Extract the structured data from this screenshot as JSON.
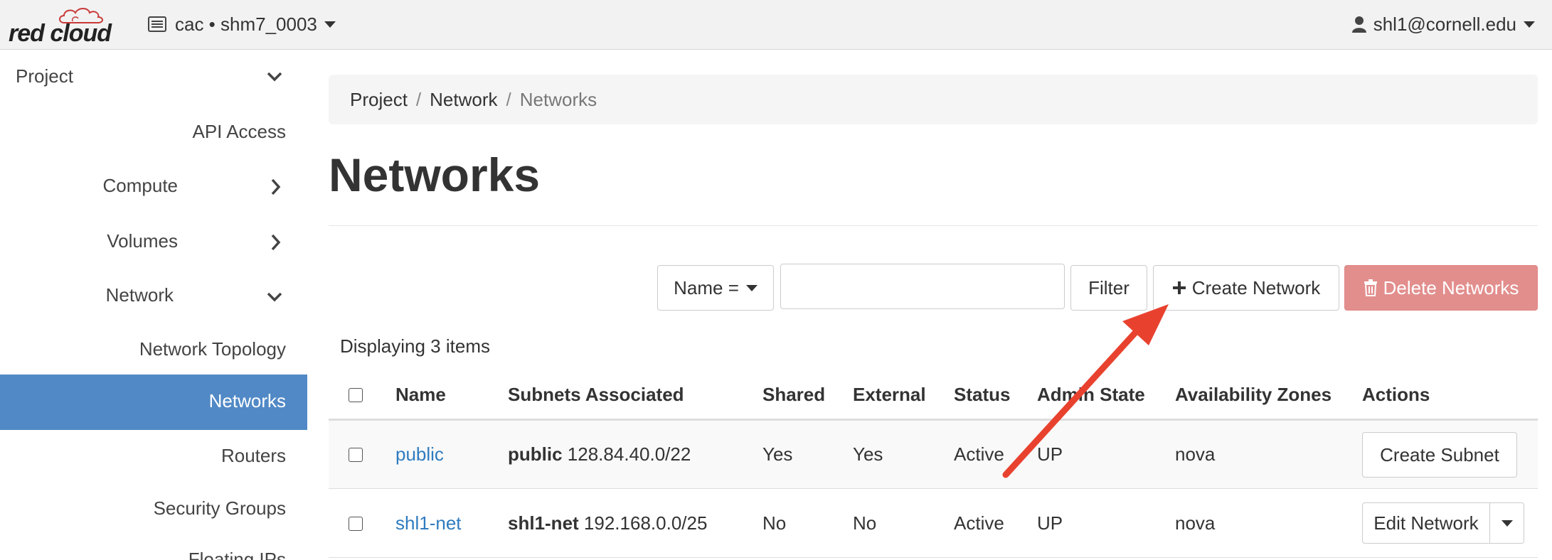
{
  "topbar": {
    "logo_text": "red cloud",
    "project_switcher": "cac • shm7_0003",
    "user": "shl1@cornell.edu"
  },
  "sidebar": {
    "project": "Project",
    "items": [
      {
        "label": "API Access"
      },
      {
        "label": "Compute"
      },
      {
        "label": "Volumes"
      },
      {
        "label": "Network"
      },
      {
        "label": "Network Topology"
      },
      {
        "label": "Networks"
      },
      {
        "label": "Routers"
      },
      {
        "label": "Security Groups"
      },
      {
        "label": "Floating IPs"
      }
    ]
  },
  "breadcrumb": [
    "Project",
    "Network",
    "Networks"
  ],
  "page_title": "Networks",
  "toolbar": {
    "filter_select": "Name =",
    "filter_value": "",
    "filter_button": "Filter",
    "create_button": "Create Network",
    "delete_button": "Delete Networks"
  },
  "table": {
    "count_text": "Displaying 3 items",
    "headers": [
      "Name",
      "Subnets Associated",
      "Shared",
      "External",
      "Status",
      "Admin State",
      "Availability Zones",
      "Actions"
    ],
    "rows": [
      {
        "name": "public",
        "subnet_name": "public",
        "subnet_cidr": "128.84.40.0/22",
        "shared": "Yes",
        "external": "Yes",
        "status": "Active",
        "admin_state": "UP",
        "zones": "nova",
        "action": "Create Subnet"
      },
      {
        "name": "shl1-net",
        "subnet_name": "shl1-net",
        "subnet_cidr": "192.168.0.0/25",
        "shared": "No",
        "external": "No",
        "status": "Active",
        "admin_state": "UP",
        "zones": "nova",
        "action": "Edit Network"
      }
    ]
  },
  "colors": {
    "accent": "#5189c6",
    "link": "#2f7bbf",
    "danger": "#e28e8d",
    "annotation_arrow": "#e8422f"
  },
  "icons": {
    "project_switcher": "server-list-icon",
    "user": "user-icon",
    "create": "plus-icon",
    "delete": "trash-icon"
  }
}
